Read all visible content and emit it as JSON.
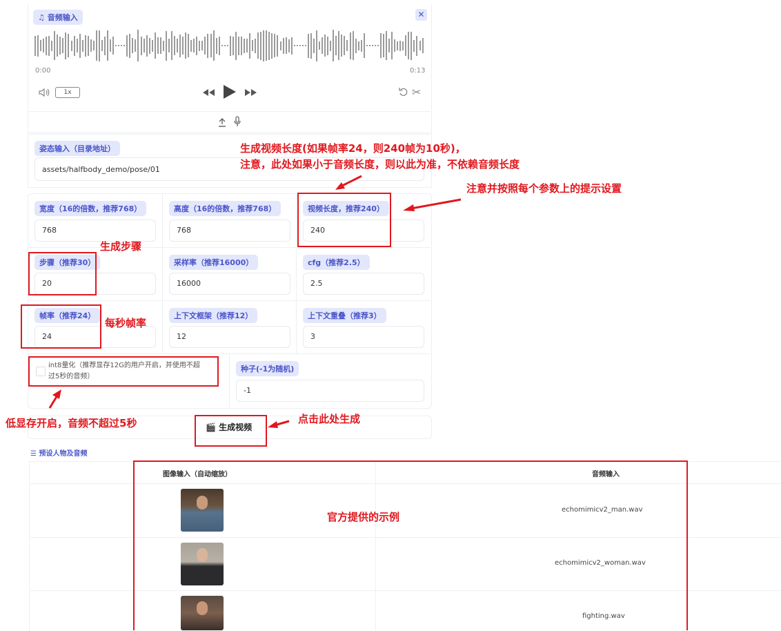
{
  "audio": {
    "label": "音频输入",
    "time_start": "0:00",
    "time_end": "0:13",
    "speed": "1x"
  },
  "pose": {
    "label": "姿态输入（目录地址）",
    "value": "assets/halfbody_demo/pose/01"
  },
  "params": {
    "width": {
      "label": "宽度（16的倍数，推荐768）",
      "value": "768"
    },
    "height": {
      "label": "高度（16的倍数，推荐768）",
      "value": "768"
    },
    "length": {
      "label": "视频长度，推荐240）",
      "value": "240"
    },
    "steps": {
      "label": "步骤（推荐30）",
      "value": "20"
    },
    "sample_rate": {
      "label": "采样率（推荐16000）",
      "value": "16000"
    },
    "cfg": {
      "label": "cfg（推荐2.5）",
      "value": "2.5"
    },
    "fps": {
      "label": "帧率（推荐24）",
      "value": "24"
    },
    "context_frames": {
      "label": "上下文框架（推荐12）",
      "value": "12"
    },
    "context_overlap": {
      "label": "上下文重叠（推荐3）",
      "value": "3"
    },
    "int8_line1": "int8量化（推荐显存12G的用户开启，并使用不超",
    "int8_line2": "过5秒的音频）",
    "seed": {
      "label": "种子(-1为随机)",
      "value": "-1"
    }
  },
  "generate_button": "生成视频",
  "examples": {
    "title": "预设人物及音频",
    "col_image": "图像输入（自动缩放）",
    "col_audio": "音频输入",
    "rows": [
      {
        "audio": "echomimicv2_man.wav"
      },
      {
        "audio": "echomimicv2_woman.wav"
      },
      {
        "audio": "fighting.wav"
      }
    ]
  },
  "annotations": {
    "length_note_1": "生成视频长度(如果帧率24，则240帧为10秒)，",
    "length_note_2": "注意，此处如果小于音频长度，则以此为准，不依赖音频长度",
    "follow_hints": "注意并按照每个参数上的提示设置",
    "steps_note": "生成步骤",
    "fps_note": "每秒帧率",
    "lowmem_note": "低显存开启，音频不超过5秒",
    "click_note": "点击此处生成",
    "examples_note": "官方提供的示例"
  },
  "colors": {
    "annotation_red": "#e0181e",
    "tag_bg": "#e3e7fb",
    "tag_text": "#4a55c9"
  }
}
